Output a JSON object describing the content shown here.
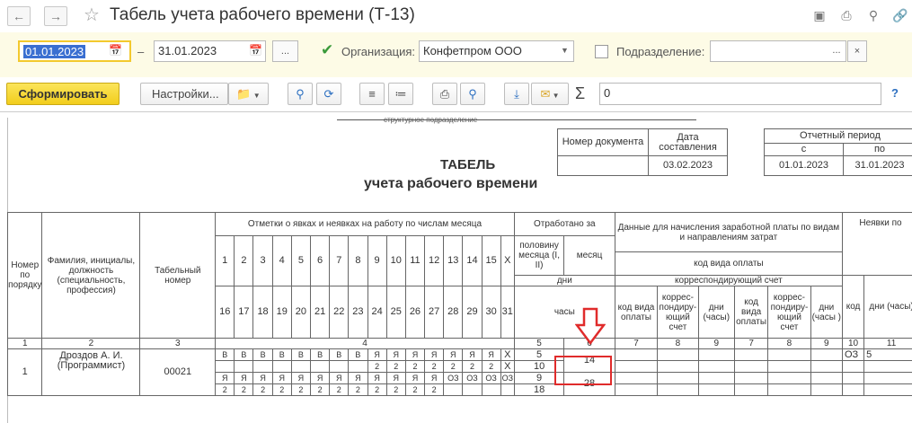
{
  "title": "Табель учета рабочего времени (Т-13)",
  "filters": {
    "date_from": "01.01.2023",
    "dash": "–",
    "date_to": "31.01.2023",
    "more": "...",
    "org_label": "Организация:",
    "org_value": "Конфетпром ООО",
    "subdiv_label": "Подразделение:",
    "subdiv_value": "",
    "subdiv_more": "...",
    "clear": "×"
  },
  "toolbar": {
    "generate": "Сформировать",
    "settings": "Настройки...",
    "sum_symbol": "Σ",
    "sum_value": "0",
    "help": "?"
  },
  "report": {
    "unit_caption": "структурное подразделение",
    "doc_number_header": "Номер документа",
    "doc_date_header": "Дата составления",
    "doc_number": "",
    "doc_date": "03.02.2023",
    "period_header": "Отчетный период",
    "period_from_label": "с",
    "period_to_label": "по",
    "period_from": "01.01.2023",
    "period_to": "31.01.2023",
    "heading1": "ТАБЕЛЬ",
    "heading2": "учета  рабочего времени",
    "col_num": "Номер по порядку",
    "col_name": "Фамилия, инициалы, должность (специальность, профессия)",
    "col_tab": "Табельный номер",
    "col_marks": "Отметки о явках и неявках на работу по числам месяца",
    "col_worked": "Отработано за",
    "col_half": "половину месяца (I, II)",
    "col_month": "месяц",
    "col_days": "дни",
    "col_hours": "часы",
    "col_pay": "Данные для начисления заработной платы по видам и направлениям затрат",
    "col_paycode": "код вида оплаты",
    "col_corr": "корреспондирующий счет",
    "col_paycode_short": "код вида оплаты",
    "col_corr_short": "коррес-пондиру-ющий счет",
    "col_dayshours": "дни (часы)",
    "col_dayshours2": "дни (часы )",
    "col_absence": "Неявки по",
    "col_code": "код",
    "col_dayshours3": "дни (часы)",
    "days_row1": [
      "1",
      "2",
      "3",
      "4",
      "5",
      "6",
      "7",
      "8",
      "9",
      "10",
      "11",
      "12",
      "13",
      "14",
      "15",
      "X"
    ],
    "days_row2": [
      "16",
      "17",
      "18",
      "19",
      "20",
      "21",
      "22",
      "23",
      "24",
      "25",
      "26",
      "27",
      "28",
      "29",
      "30",
      "31"
    ],
    "colnums": [
      "1",
      "2",
      "3",
      "4",
      "5",
      "6",
      "7",
      "8",
      "9",
      "7",
      "8",
      "9",
      "10",
      "11"
    ],
    "employee": {
      "num": "1",
      "name": "Дроздов А. И. (Программист)",
      "tab": "00021",
      "marks1": [
        "В",
        "В",
        "В",
        "В",
        "В",
        "В",
        "В",
        "В",
        "Я",
        "Я",
        "Я",
        "Я",
        "Я",
        "Я",
        "Я",
        "X"
      ],
      "hours1": [
        "",
        "",
        "",
        "",
        "",
        "",
        "",
        "",
        "2",
        "2",
        "2",
        "2",
        "2",
        "2",
        "2",
        "X"
      ],
      "marks2": [
        "Я",
        "Я",
        "Я",
        "Я",
        "Я",
        "Я",
        "Я",
        "Я",
        "Я",
        "Я",
        "Я",
        "Я",
        "ОЗ",
        "ОЗ",
        "ОЗ",
        "ОЗ"
      ],
      "hours2": [
        "2",
        "2",
        "2",
        "2",
        "2",
        "2",
        "2",
        "2",
        "2",
        "2",
        "2",
        "2",
        "",
        "",
        "",
        ""
      ],
      "half1_days": "5",
      "half1_hours": "10",
      "half2_days": "9",
      "half2_hours": "18",
      "month_days": "14",
      "month_hours": "28",
      "absence_code": "ОЗ",
      "absence_days": "5"
    }
  }
}
